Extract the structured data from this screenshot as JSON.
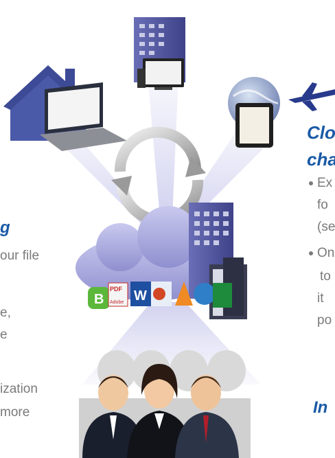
{
  "left_text": {
    "heading_fragment": "g",
    "line1": "our file",
    "line2": "e,",
    "line3": "e",
    "line4": "ization",
    "line5": "more"
  },
  "right_text": {
    "heading_line1": "Clo",
    "heading_line2": "cha",
    "bullet1_line1": "Ex",
    "bullet1_line2": "fo",
    "bullet1_line3": "(se",
    "bullet2_line1": "On",
    "bullet2_line2": "to",
    "bullet2_line3": "it",
    "bullet2_line4": "po",
    "footer": "In"
  },
  "logo_text": {
    "pdf": "PDF",
    "adobe": "Adobe"
  },
  "colors": {
    "heading_blue": "#1a5aa6",
    "body_grey": "#7a7a7a",
    "cloud_purple": "#a9a9d6",
    "building_blue": "#5f63a8"
  }
}
